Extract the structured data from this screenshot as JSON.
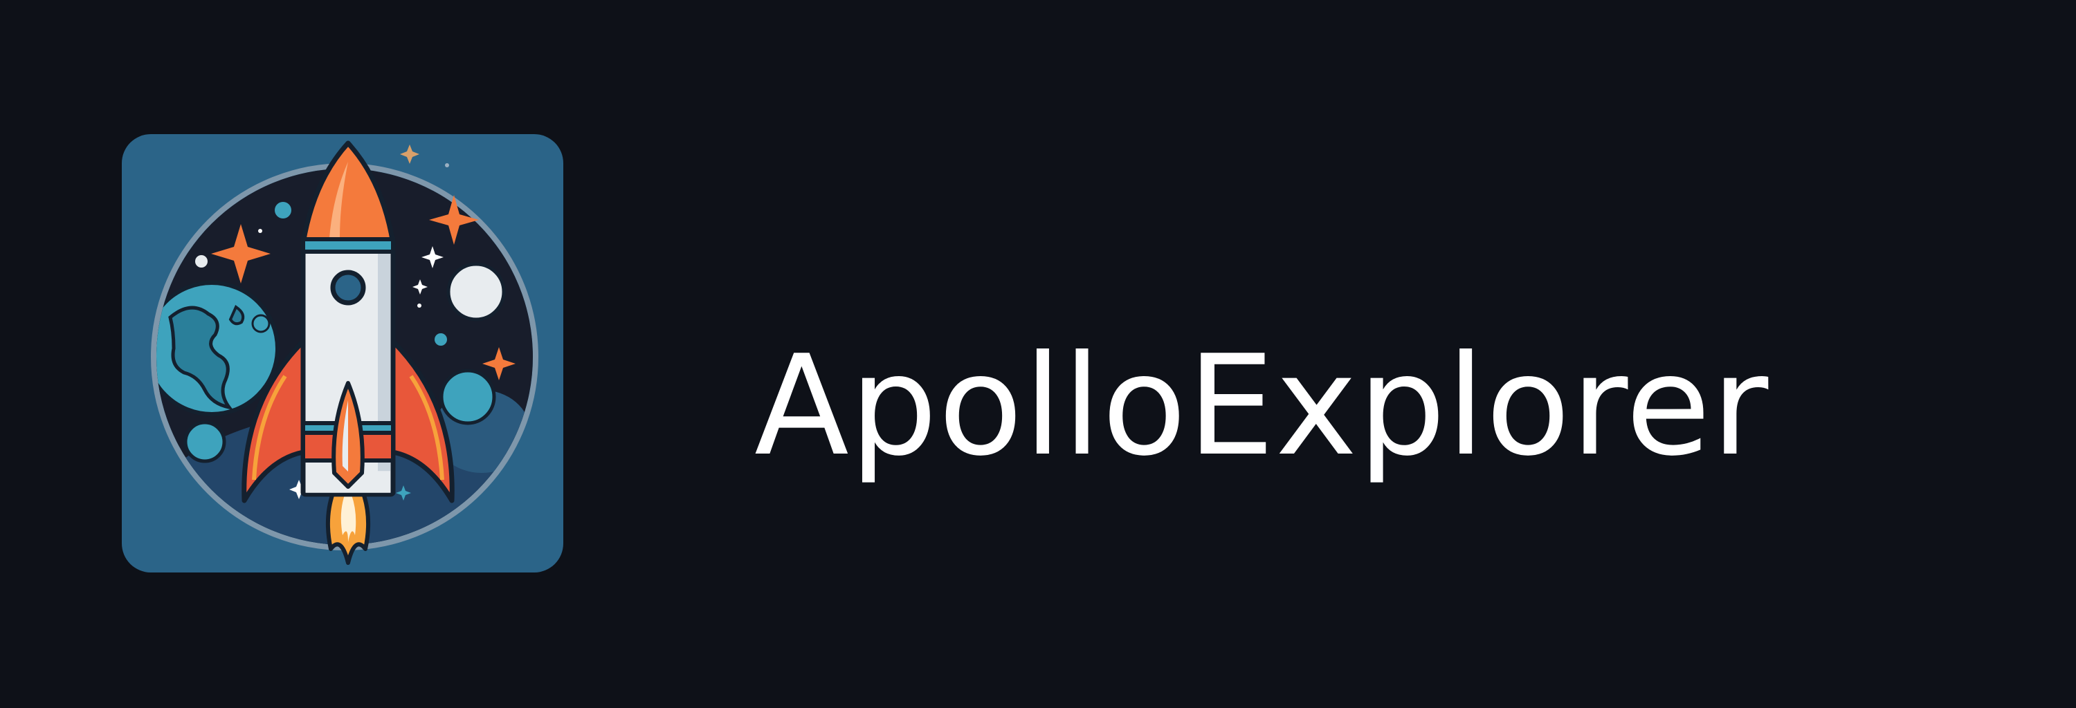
{
  "app_name": "ApolloExplorer",
  "logo": {
    "icon": "rocket-launch-icon",
    "colors": {
      "tile": "#2b6488",
      "space": "#181d2b",
      "rocket_body": "#e8ecef",
      "rocket_nose": "#f47a3c",
      "fins": "#e8573a",
      "flame": "#f7a23b",
      "earth": "#3ea3bd",
      "moon": "#e8ecef"
    }
  },
  "colors": {
    "background": "#0e1118",
    "text": "#ffffff"
  }
}
